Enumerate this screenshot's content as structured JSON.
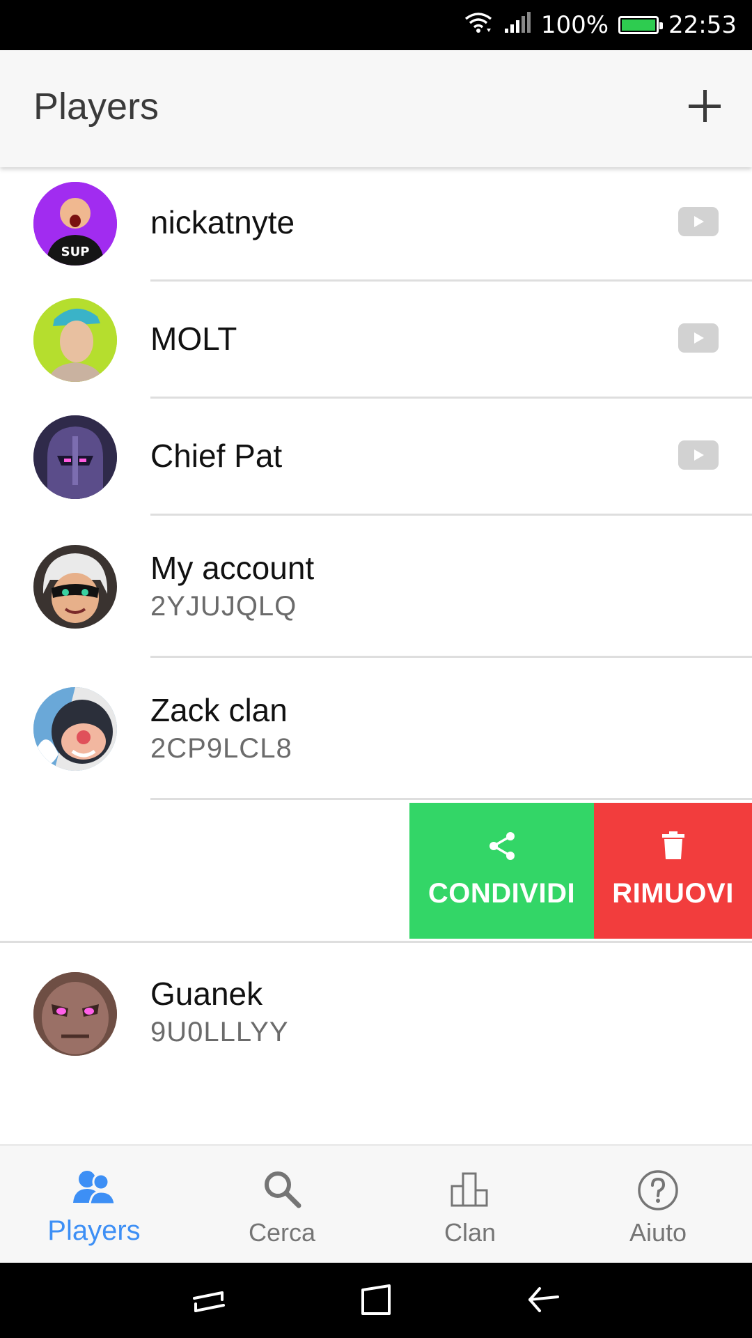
{
  "status_bar": {
    "battery": "100%",
    "time": "22:53",
    "battery_color": "#2ecc50",
    "icons": [
      "wifi-icon",
      "signal-icon",
      "battery-icon"
    ]
  },
  "header": {
    "title": "Players",
    "add_icon": "plus-icon"
  },
  "players": [
    {
      "name": "nickatnyte",
      "tag": "",
      "avatar_color": "#a12cf0",
      "video_icon": "youtube-icon"
    },
    {
      "name": "MOLT",
      "tag": "",
      "avatar_color": "#b5de2e",
      "video_icon": "youtube-icon"
    },
    {
      "name": "Chief Pat",
      "tag": "",
      "avatar_color": "#4b3b7a",
      "video_icon": "youtube-icon"
    },
    {
      "name": "My account",
      "tag": "2YJUJQLQ",
      "avatar_color": "#d9d9d9"
    },
    {
      "name": "Zack clan",
      "tag": "2CP9LCL8",
      "avatar_color": "#6aa8d8"
    },
    {
      "name": "Guanek",
      "tag": "9U0LLLYY",
      "avatar_color": "#8a5a4a"
    }
  ],
  "swipe_actions": {
    "share": {
      "label": "CONDIVIDI",
      "icon": "share-icon",
      "color": "#33d667"
    },
    "remove": {
      "label": "RIMUOVI",
      "icon": "trash-icon",
      "color": "#f23d3d"
    }
  },
  "bottom_nav": [
    {
      "label": "Players",
      "icon": "players-icon",
      "active": true
    },
    {
      "label": "Cerca",
      "icon": "search-icon",
      "active": false
    },
    {
      "label": "Clan",
      "icon": "clan-icon",
      "active": false
    },
    {
      "label": "Aiuto",
      "icon": "help-icon",
      "active": false
    }
  ],
  "accent_color": "#3d8ff5"
}
